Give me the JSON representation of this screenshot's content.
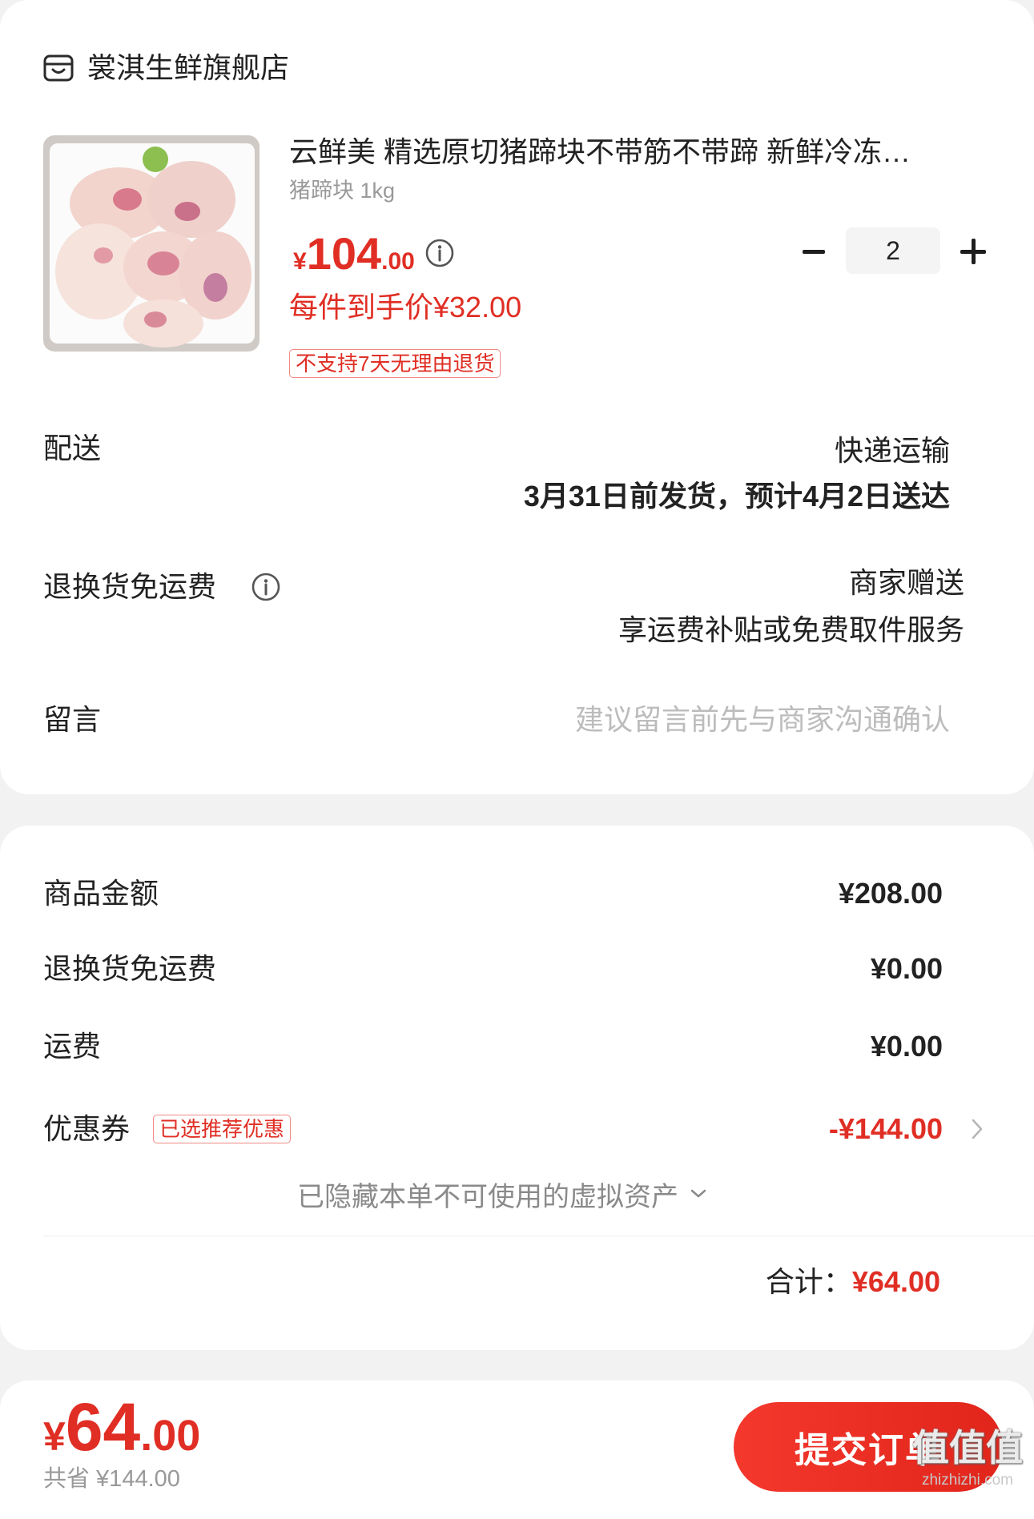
{
  "theme": {
    "accent": "#e02e24",
    "text": "#222222",
    "muted": "#999999",
    "placeholder": "#bcbcbc"
  },
  "store": {
    "icon": "store-icon",
    "name": "裳淇生鲜旗舰店"
  },
  "product": {
    "image": "product-image",
    "title": "云鲜美 精选原切猪蹄块不带筋不带蹄 新鲜冷冻…",
    "spec": "猪蹄块 1kg",
    "price": {
      "currency": "¥",
      "integer": "104",
      "decimal": ".00"
    },
    "price_info_icon": "info-icon",
    "unit_price": "每件到手价¥32.00",
    "return_badge": "不支持7天无理由退货",
    "quantity": {
      "value": "2",
      "minus_icon": "minus-icon",
      "plus_icon": "plus-icon"
    }
  },
  "delivery": {
    "label": "配送",
    "method": "快递运输",
    "eta": "3月31日前发货，预计4月2日送达"
  },
  "return_shipping": {
    "label": "退换货免运费",
    "info_icon": "info-icon",
    "value": "商家赠送",
    "desc": "享运费补贴或免费取件服务"
  },
  "message": {
    "label": "留言",
    "placeholder": "建议留言前先与商家沟通确认"
  },
  "summary": {
    "rows": [
      {
        "label": "商品金额",
        "value": "¥208.00"
      },
      {
        "label": "退换货免运费",
        "value": "¥0.00"
      },
      {
        "label": "运费",
        "value": "¥0.00"
      }
    ],
    "coupon": {
      "label": "优惠券",
      "badge": "已选推荐优惠",
      "value": "-¥144.00",
      "chevron_icon": "chevron-right-icon"
    },
    "hidden_assets": {
      "text": "已隐藏本单不可使用的虚拟资产",
      "chevron_icon": "chevron-down-icon"
    },
    "total": {
      "label": "合计：",
      "value": "¥64.00"
    }
  },
  "footer": {
    "price": {
      "currency": "¥",
      "integer": "64",
      "decimal": ".00"
    },
    "saved": "共省 ¥144.00",
    "submit_label": "提交订单"
  },
  "watermark": {
    "glyphs": "值值值",
    "site": "zhizhizhi.com"
  }
}
